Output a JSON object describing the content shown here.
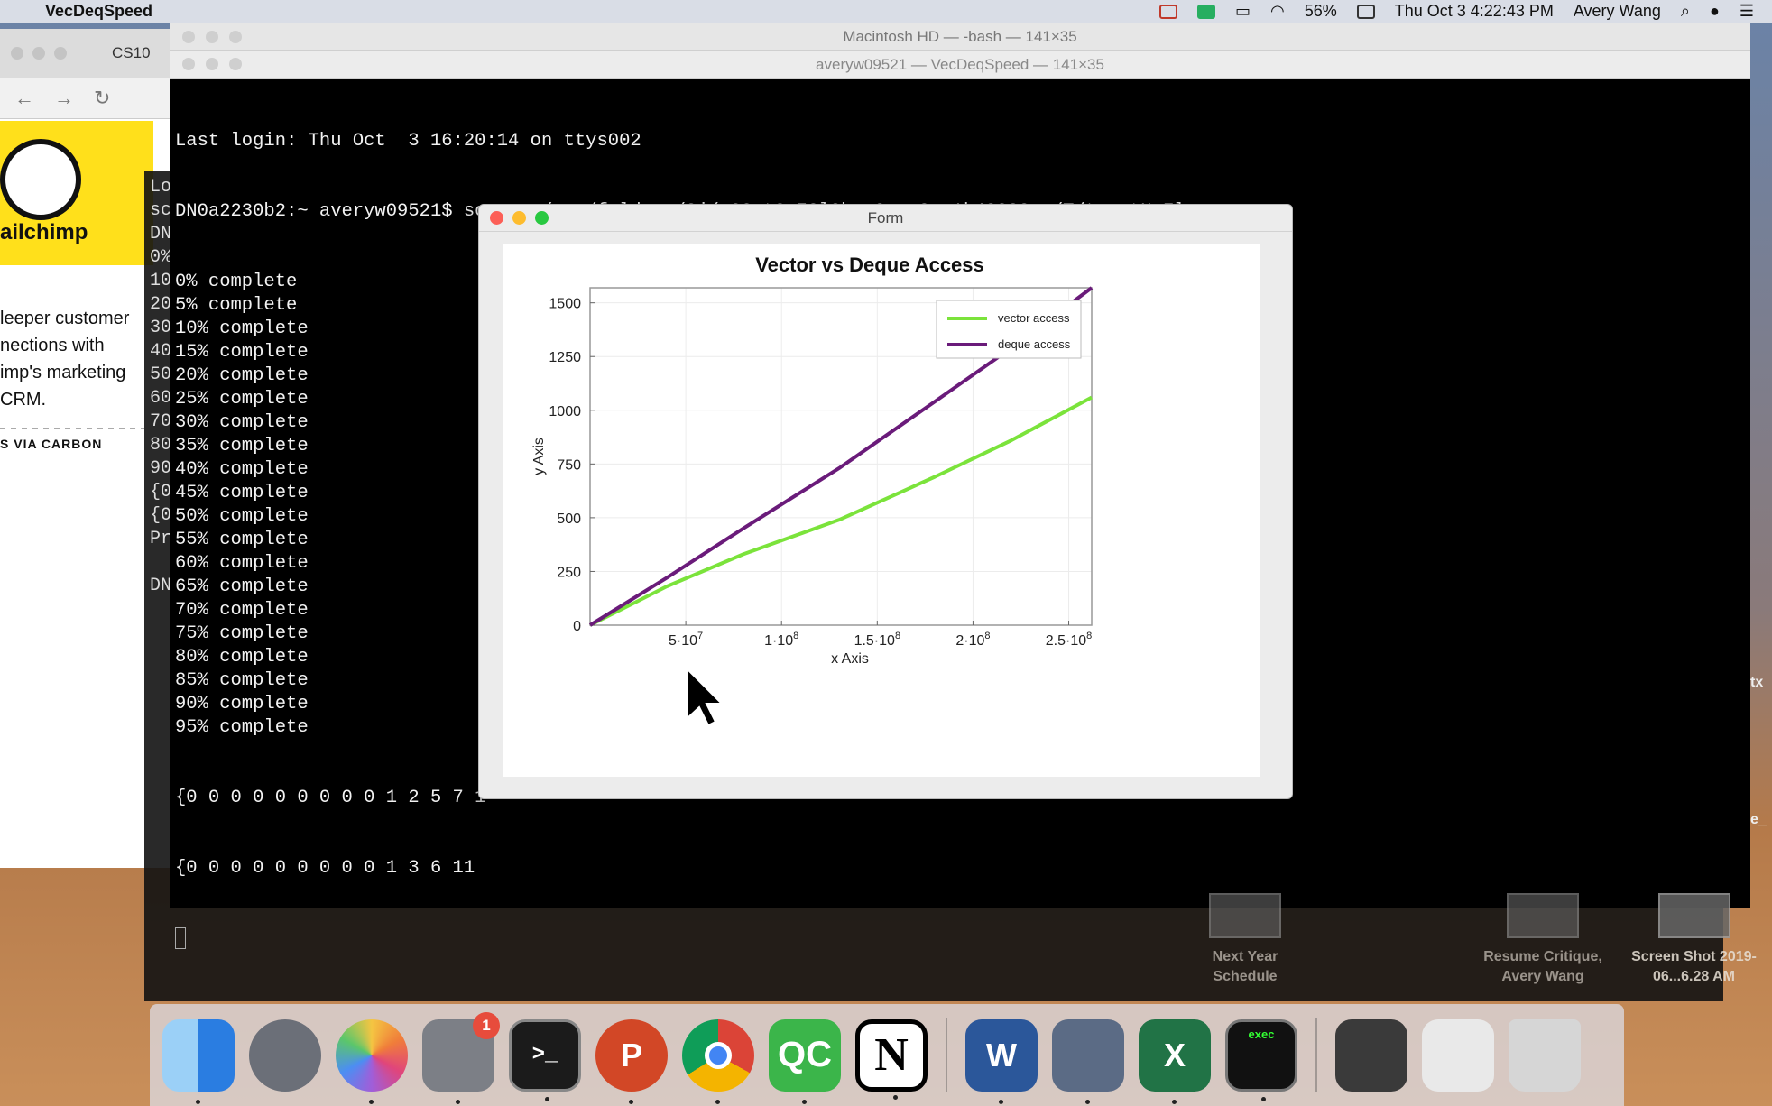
{
  "menubar": {
    "app_name": "VecDeqSpeed",
    "battery": "56%",
    "datetime": "Thu Oct 3  4:22:43 PM",
    "user": "Avery Wang"
  },
  "browser": {
    "tab_label": "CS10",
    "brand": "ailchimp",
    "ad_text": "leeper customer nections with imp's marketing CRM.",
    "carbon": "S VIA CARBON"
  },
  "terminal": {
    "title_back": "Macintosh HD — -bash — 141×35",
    "title": "averyw09521 — VecDeqSpeed — 141×35",
    "login": "Last login: Thu Oct  3 16:20:14 on ttys002",
    "prompt": "DN0a2230b2:~ averyw09521$ source /var/folders/3j/n22wt3s50l9bqx0zyy0zy1k40000gn/T/tmputHuFl",
    "progress": [
      "0% complete",
      "5% complete",
      "10% complete",
      "15% complete",
      "20% complete",
      "25% complete",
      "30% complete",
      "35% complete",
      "40% complete",
      "45% complete",
      "50% complete",
      "55% complete",
      "60% complete",
      "65% complete",
      "70% complete",
      "75% complete",
      "80% complete",
      "85% complete",
      "90% complete",
      "95% complete"
    ],
    "out1": "{0 0 0 0 0 0 0 0 0 1 2 5 7 1",
    "out2": "{0 0 0 0 0 0 0 0 0 1 3 6 11",
    "back_col": [
      "Lo",
      "sc",
      "DN",
      "0%",
      "10",
      "20",
      "30",
      "40",
      "50",
      "60",
      "70",
      "80",
      "90",
      "{0",
      "{0",
      "Pr",
      "",
      "DN"
    ]
  },
  "form": {
    "title": "Form"
  },
  "chart_data": {
    "type": "line",
    "title": "Vector vs Deque Access",
    "xlabel": "x Axis",
    "ylabel": "y Axis",
    "xlim": [
      0,
      262000000
    ],
    "ylim": [
      0,
      1570
    ],
    "xticks": [
      50000000,
      100000000,
      150000000,
      200000000,
      250000000
    ],
    "xtick_labels": [
      [
        "5·10",
        "7"
      ],
      [
        "1·10",
        "8"
      ],
      [
        "1.5·10",
        "8"
      ],
      [
        "2·10",
        "8"
      ],
      [
        "2.5·10",
        "8"
      ]
    ],
    "yticks": [
      0,
      250,
      500,
      750,
      1000,
      1250,
      1500
    ],
    "grid": true,
    "legend": "top-right",
    "series": [
      {
        "name": "vector access",
        "color": "#7be33b",
        "x": [
          0,
          40000000,
          80000000,
          130000000,
          180000000,
          220000000,
          262000000
        ],
        "y": [
          0,
          180,
          330,
          490,
          690,
          860,
          1060
        ]
      },
      {
        "name": "deque access",
        "color": "#6a1b7a",
        "x": [
          0,
          40000000,
          80000000,
          130000000,
          180000000,
          220000000,
          262000000
        ],
        "y": [
          0,
          220,
          450,
          730,
          1040,
          1290,
          1570
        ]
      }
    ]
  },
  "desktop": {
    "items": [
      "Next Year Schedule",
      "Resume Critique, Avery Wang",
      "Screen Shot 2019-06...6.28 AM"
    ],
    "side_tx": "tx",
    "side_e": "e_"
  },
  "dock": {
    "items": [
      "finder",
      "launchpad",
      "photos",
      "system-preferences",
      "terminal",
      "powerpoint",
      "chrome",
      "qc",
      "notion",
      "word",
      "imovie",
      "excel",
      "exec",
      "scanner",
      "document",
      "trash"
    ],
    "prefs_badge": "1",
    "qc_label": "QC",
    "notion_label": "N",
    "word_label": "W",
    "excel_label": "X",
    "ppt_label": "P",
    "exec_label": "exec",
    "terminal_label": ">_"
  }
}
